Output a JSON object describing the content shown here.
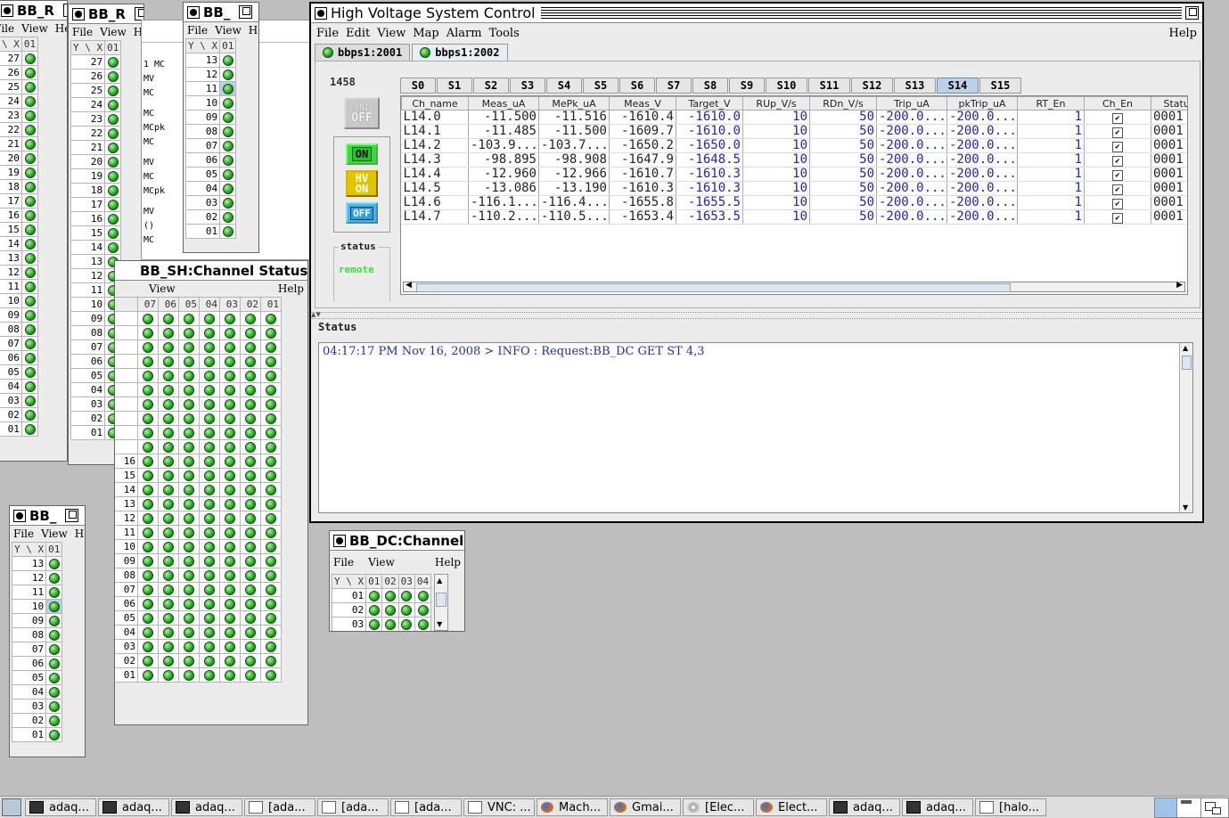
{
  "small_windows": {
    "bb_r1": {
      "title": "BB_R",
      "menu": [
        "File",
        "View",
        "Help"
      ],
      "header": [
        "\\ X",
        "01"
      ],
      "rows": [
        "27",
        "26",
        "25",
        "24",
        "23",
        "22",
        "21",
        "20",
        "19",
        "18",
        "17",
        "16",
        "15",
        "14",
        "13",
        "12",
        "11",
        "10",
        "09",
        "08",
        "07",
        "06",
        "05",
        "04",
        "03",
        "02",
        "01"
      ]
    },
    "bb_r2": {
      "title": "BB_R",
      "menu": [
        "File",
        "View",
        "Help"
      ],
      "header": [
        "Y \\ X",
        "01"
      ],
      "rows": [
        "27",
        "26",
        "25",
        "24",
        "23",
        "22",
        "21",
        "20",
        "19",
        "18",
        "17",
        "16",
        "15",
        "14",
        "13",
        "12",
        "11",
        "10",
        "09",
        "08",
        "07",
        "06",
        "05",
        "04",
        "03",
        "02",
        "01"
      ]
    },
    "bb_3": {
      "title": "BB_",
      "menu": [
        "File",
        "View",
        "Help"
      ],
      "header": [
        "Y \\ X",
        "01"
      ],
      "rows": [
        "13",
        "12",
        "11",
        "10",
        "09",
        "08",
        "07",
        "06",
        "05",
        "04",
        "03",
        "02",
        "01"
      ]
    },
    "bb_4": {
      "title": "BB_",
      "menu": [
        "File",
        "View",
        "Help"
      ],
      "header": [
        "Y \\ X",
        "01"
      ],
      "rows": [
        "13",
        "12",
        "11",
        "10",
        "09",
        "08",
        "07",
        "06",
        "05",
        "04",
        "03",
        "02",
        "01"
      ]
    },
    "hidden_labels": [
      "1 MC",
      "MV",
      "MC",
      "MC",
      "MCpk",
      "MC",
      "MV",
      "MC",
      "MCpk",
      "MV",
      "()",
      "MC"
    ],
    "bb_sh": {
      "title": "BB_SH:Channel Status",
      "menu": [
        "View",
        "Help"
      ],
      "cols": [
        "07",
        "06",
        "05",
        "04",
        "03",
        "02",
        "01"
      ],
      "rows": [
        "16",
        "15",
        "14",
        "13",
        "12",
        "11",
        "10",
        "09",
        "08",
        "07",
        "06",
        "05",
        "04",
        "03",
        "02",
        "01"
      ]
    },
    "bb_dc": {
      "title": "BB_DC:Channel",
      "menu": [
        "File",
        "View",
        "Help"
      ],
      "header": [
        "Y \\ X",
        "01",
        "02",
        "03",
        "04"
      ],
      "rows": [
        "01",
        "02",
        "03"
      ]
    }
  },
  "main": {
    "title": "High Voltage System Control",
    "menu": [
      "File",
      "Edit",
      "View",
      "Map",
      "Alarm",
      "Tools"
    ],
    "help": "Help",
    "crate_tabs": [
      "bbps1:2001",
      "bbps1:2002"
    ],
    "active_crate": "bbps1:2002",
    "crate_id": "1458",
    "panic_label": [
      "PANIC",
      "OFF"
    ],
    "on_label": "ON",
    "hv_label": [
      "HV",
      "ON"
    ],
    "off_label": "OFF",
    "status_group_label": "status",
    "status_value": "remote",
    "slot_tabs": [
      "S0",
      "S1",
      "S2",
      "S3",
      "S4",
      "S5",
      "S6",
      "S7",
      "S8",
      "S9",
      "S10",
      "S11",
      "S12",
      "S13",
      "S14",
      "S15"
    ],
    "active_slot": "S14",
    "columns": [
      "Ch_name",
      "Meas_uA",
      "MePk_uA",
      "Meas_V",
      "Target_V",
      "RUp_V/s",
      "RDn_V/s",
      "Trip_uA",
      "pkTrip_uA",
      "RT_En",
      "Ch_En",
      "Status"
    ],
    "rows": [
      [
        "L14.0",
        "-11.500",
        "-11.516",
        "-1610.4",
        "-1610.0",
        "10",
        "50",
        "-200.0...",
        "-200.0...",
        "1",
        "✔",
        "0001"
      ],
      [
        "L14.1",
        "-11.485",
        "-11.500",
        "-1609.7",
        "-1610.0",
        "10",
        "50",
        "-200.0...",
        "-200.0...",
        "1",
        "✔",
        "0001"
      ],
      [
        "L14.2",
        "-103.9...",
        "-103.7...",
        "-1650.2",
        "-1650.0",
        "10",
        "50",
        "-200.0...",
        "-200.0...",
        "1",
        "✔",
        "0001"
      ],
      [
        "L14.3",
        "-98.895",
        "-98.908",
        "-1647.9",
        "-1648.5",
        "10",
        "50",
        "-200.0...",
        "-200.0...",
        "1",
        "✔",
        "0001"
      ],
      [
        "L14.4",
        "-12.960",
        "-12.966",
        "-1610.7",
        "-1610.3",
        "10",
        "50",
        "-200.0...",
        "-200.0...",
        "1",
        "✔",
        "0001"
      ],
      [
        "L14.5",
        "-13.086",
        "-13.190",
        "-1610.3",
        "-1610.3",
        "10",
        "50",
        "-200.0...",
        "-200.0...",
        "1",
        "✔",
        "0001"
      ],
      [
        "L14.6",
        "-116.1...",
        "-116.4...",
        "-1655.8",
        "-1655.5",
        "10",
        "50",
        "-200.0...",
        "-200.0...",
        "1",
        "✔",
        "0001"
      ],
      [
        "L14.7",
        "-110.2...",
        "-110.5...",
        "-1653.4",
        "-1653.5",
        "10",
        "50",
        "-200.0...",
        "-200.0...",
        "1",
        "✔",
        "0001"
      ]
    ],
    "status_panel_label": "Status",
    "log_line": "04:17:17 PM Nov 16, 2008 > INFO : Request:BB_DC GET ST 4,3"
  },
  "taskbar": [
    {
      "label": "adaq...",
      "icon": "terminal-icon"
    },
    {
      "label": "adaq...",
      "icon": "terminal-icon"
    },
    {
      "label": "adaq...",
      "icon": "terminal-icon"
    },
    {
      "label": "[ada...",
      "icon": "window-icon"
    },
    {
      "label": "[ada...",
      "icon": "window-icon"
    },
    {
      "label": "[ada...",
      "icon": "window-icon"
    },
    {
      "label": "VNC: ...",
      "icon": "window-icon"
    },
    {
      "label": "Mach...",
      "icon": "firefox-icon"
    },
    {
      "label": "Gmai...",
      "icon": "firefox-icon"
    },
    {
      "label": "[Elec...",
      "icon": "chromium-icon"
    },
    {
      "label": "Elect...",
      "icon": "firefox-icon"
    },
    {
      "label": "adaq...",
      "icon": "terminal-icon"
    },
    {
      "label": "adaq...",
      "icon": "terminal-icon"
    },
    {
      "label": "[halo...",
      "icon": "window-icon"
    }
  ]
}
